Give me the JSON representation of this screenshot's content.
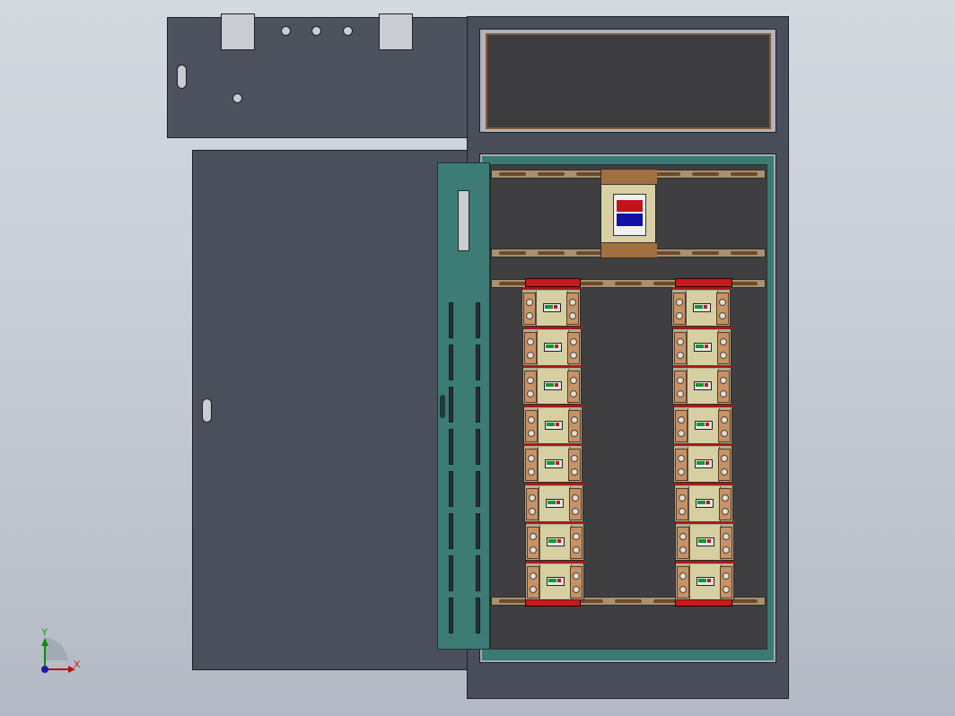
{
  "viewport": {
    "axis_labels": {
      "y": "Y",
      "x": "X"
    },
    "colors": {
      "background": "#c4cad3",
      "panel": "#4e525e",
      "door_panel": "#3d7b75",
      "busbar": "#c9181c",
      "din_rail": "#a7916f",
      "breaker_body": "#d6cfa2",
      "switch_red": "#c2121e",
      "switch_blue": "#1212a6",
      "indicator_on": "#0c9a26"
    }
  },
  "assembly": {
    "main_switch": {
      "icon": "isolator-switch-icon"
    },
    "breaker_columns": [
      {
        "name": "left",
        "breaker_count": 8
      },
      {
        "name": "right",
        "breaker_count": 8
      }
    ],
    "top_panel": {
      "meters": 2,
      "indicator_lamps": 3
    }
  }
}
